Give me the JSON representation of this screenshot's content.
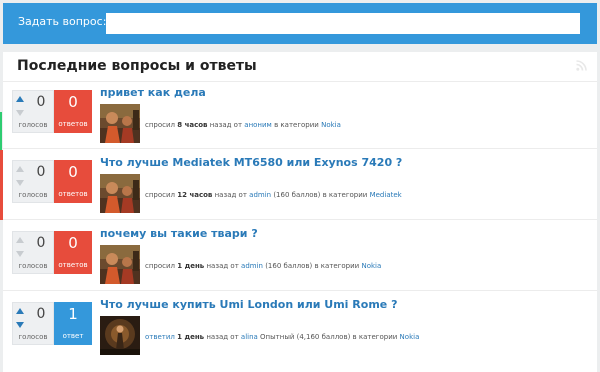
{
  "ask": {
    "label": "Задать вопрос:",
    "placeholder": ""
  },
  "panel": {
    "title": "Последние вопросы и ответы",
    "rss_icon": "rss-icon"
  },
  "questions": [
    {
      "votes": "0",
      "votes_label": "голосов",
      "answers": "0",
      "answers_label": "ответов",
      "title": "привет как дела",
      "action": "спросил",
      "when": "8 часов",
      "ago": "назад от",
      "author": "аноним",
      "author_info": "",
      "in_category": "в категории",
      "category": "Nokia",
      "answered": false
    },
    {
      "votes": "0",
      "votes_label": "голосов",
      "answers": "0",
      "answers_label": "ответов",
      "title": "Что лучше Mediatek MT6580 или Exynos 7420 ?",
      "action": "спросил",
      "when": "12 часов",
      "ago": "назад от",
      "author": "admin",
      "author_info": "(160 баллов)",
      "in_category": "в категории",
      "category": "Mediatek",
      "answered": false
    },
    {
      "votes": "0",
      "votes_label": "голосов",
      "answers": "0",
      "answers_label": "ответов",
      "title": "почему вы такие твари ?",
      "action": "спросил",
      "when": "1 день",
      "ago": "назад от",
      "author": "admin",
      "author_info": "(160 баллов)",
      "in_category": "в категории",
      "category": "Nokia",
      "answered": false
    },
    {
      "votes": "0",
      "votes_label": "голосов",
      "answers": "1",
      "answers_label": "ответ",
      "title": "Что лучше купить Umi London или Umi Rome ?",
      "action": "ответил",
      "when": "1 день",
      "ago": "назад от",
      "author": "alina",
      "author_info": "Опытный (4,160 баллов)",
      "in_category": "в категории",
      "category": "Nokia",
      "answered": true
    }
  ],
  "colors": {
    "accent": "#3498db",
    "no_answer": "#e74c3c",
    "answered": "#3498db",
    "link": "#2a7ab8"
  }
}
